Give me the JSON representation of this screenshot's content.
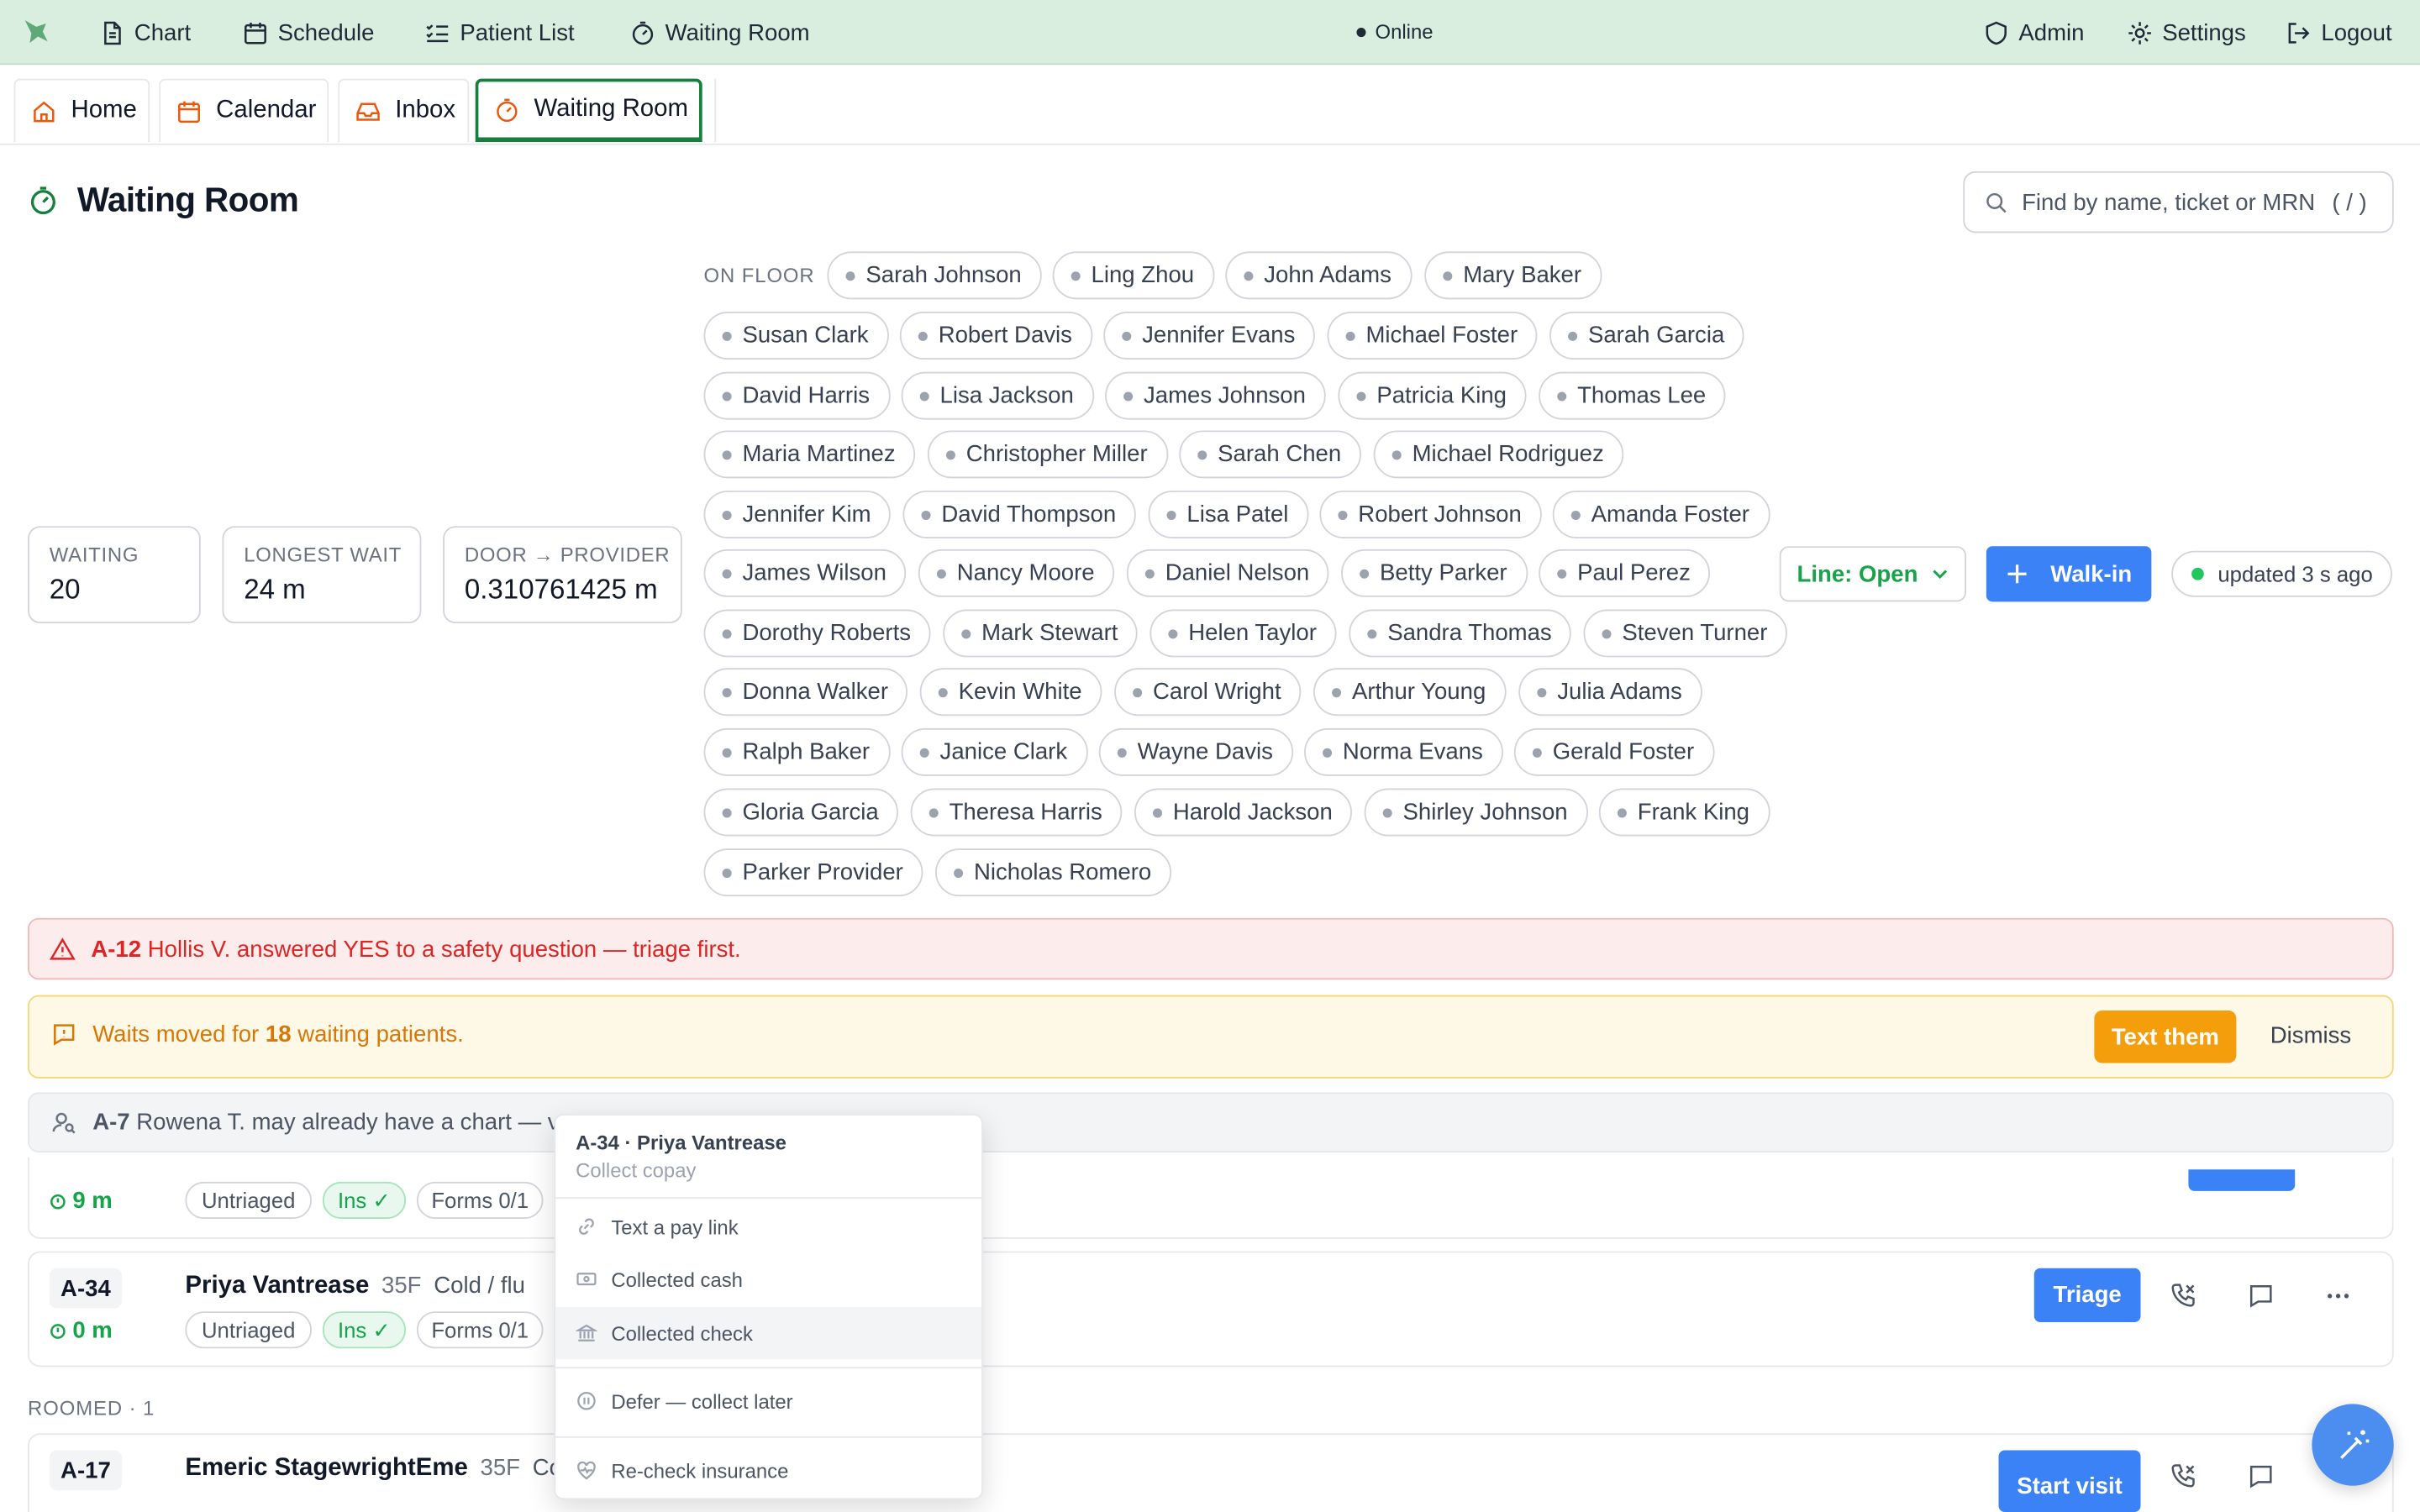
{
  "nav": {
    "chart": "Chart",
    "schedule": "Schedule",
    "patient_list": "Patient List",
    "waiting_room": "Waiting Room",
    "status": "Online",
    "admin": "Admin",
    "settings": "Settings",
    "logout": "Logout"
  },
  "tabs": [
    "Home",
    "Calendar",
    "Inbox",
    "Waiting Room"
  ],
  "page": {
    "title": "Waiting Room",
    "search_placeholder": "Find by name, ticket or MRN",
    "search_shortcut": "( / )"
  },
  "stats": [
    {
      "label": "WAITING",
      "value": "20"
    },
    {
      "label": "LONGEST WAIT",
      "value": "24 m"
    },
    {
      "label": "DOOR → PROVIDER",
      "value": "0.310761425 m"
    }
  ],
  "on_floor": {
    "label": "ON FLOOR",
    "staff": [
      "Sarah Johnson",
      "Ling Zhou",
      "John Adams",
      "Mary Baker",
      "Susan Clark",
      "Robert Davis",
      "Jennifer Evans",
      "Michael Foster",
      "Sarah Garcia",
      "David Harris",
      "Lisa Jackson",
      "James Johnson",
      "Patricia King",
      "Thomas Lee",
      "Maria Martinez",
      "Christopher Miller",
      "Sarah Chen",
      "Michael Rodriguez",
      "Jennifer Kim",
      "David Thompson",
      "Lisa Patel",
      "Robert Johnson",
      "Amanda Foster",
      "James Wilson",
      "Nancy Moore",
      "Daniel Nelson",
      "Betty Parker",
      "Paul Perez",
      "Dorothy Roberts",
      "Mark Stewart",
      "Helen Taylor",
      "Sandra Thomas",
      "Steven Turner",
      "Donna Walker",
      "Kevin White",
      "Carol Wright",
      "Arthur Young",
      "Julia Adams",
      "Ralph Baker",
      "Janice Clark",
      "Wayne Davis",
      "Norma Evans",
      "Gerald Foster",
      "Gloria Garcia",
      "Theresa Harris",
      "Harold Jackson",
      "Shirley Johnson",
      "Frank King",
      "Parker Provider",
      "Nicholas Romero"
    ]
  },
  "controls": {
    "line_status": "Line: Open",
    "walk_in": "Walk-in",
    "updated": "updated 3 s ago"
  },
  "alerts": {
    "safety_ticket": "A-12",
    "safety_text": "Hollis V. answered YES to a safety question — triage first.",
    "waits_pre": "Waits moved for",
    "waits_count": "18",
    "waits_post": "waiting patients.",
    "text_them": "Text them",
    "dismiss": "Dismiss",
    "chart_ticket": "A-7",
    "chart_text": "Rowena T. may already have a chart — ve"
  },
  "queue": [
    {
      "wait": "9 m",
      "triage": "Untriaged",
      "ins": "Ins ✓",
      "forms": "Forms 0/1"
    },
    {
      "ticket": "A-34",
      "name": "Priya Vantrease",
      "demo": "35F",
      "complaint": "Cold / flu",
      "wait": "0 m",
      "triage": "Untriaged",
      "ins": "Ins ✓",
      "forms": "Forms 0/1",
      "action": "Triage"
    }
  ],
  "roomed": {
    "label": "ROOMED · 1",
    "ticket": "A-17",
    "name": "Emeric StagewrightEme",
    "demo": "35F",
    "complaint": "Col",
    "action": "Start visit"
  },
  "menu": {
    "title": "A-34 · Priya Vantrease",
    "subtitle": "Collect copay",
    "items": [
      "Text a pay link",
      "Collected cash",
      "Collected check",
      "Defer — collect later",
      "Re-check insurance"
    ]
  },
  "colors": {
    "topbar": "#d9eede",
    "accent_green": "#15803d",
    "primary_blue": "#3b82f6",
    "danger": "#dc2626",
    "warning": "#f59e0b"
  }
}
